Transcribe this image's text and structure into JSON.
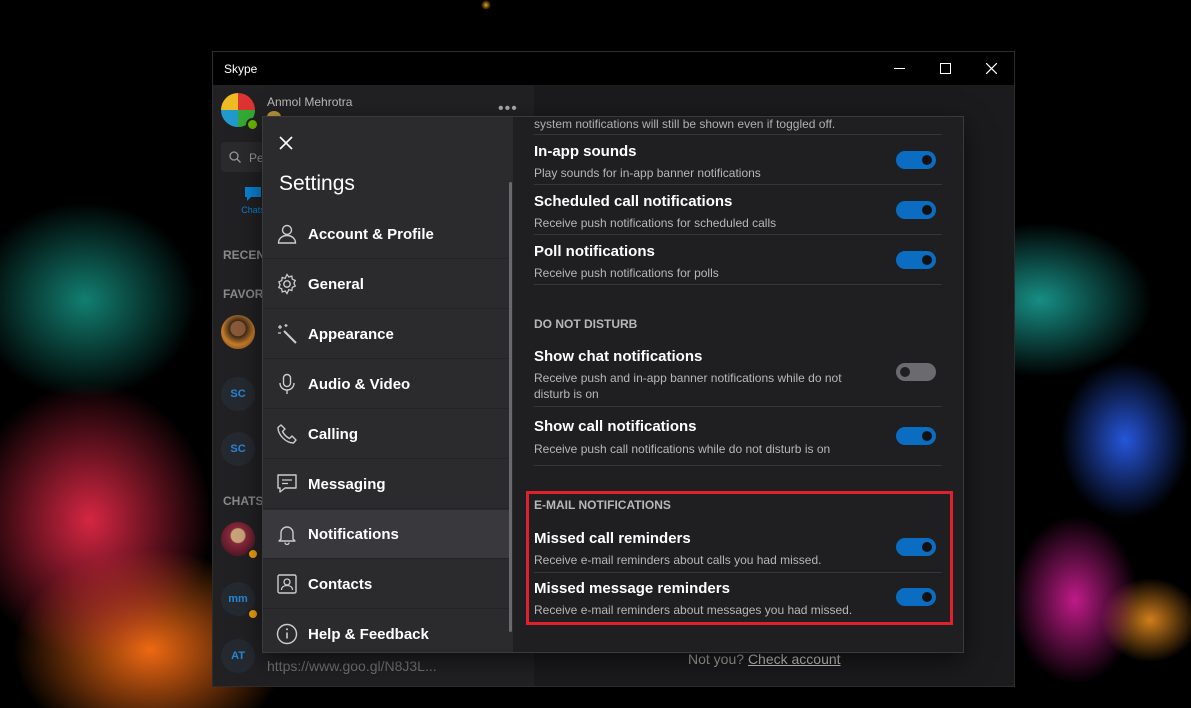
{
  "window": {
    "title": "Skype"
  },
  "window_controls": {
    "minimize": "minimize-icon",
    "maximize": "maximize-icon",
    "close": "close-icon"
  },
  "profile": {
    "name": "Anmol Mehrotra",
    "presence_color": "#6bb700"
  },
  "search": {
    "placeholder": "Pe"
  },
  "tabs": {
    "chats": "Chats"
  },
  "sidebar": {
    "recent": "RECENT",
    "favorites": "FAVOR",
    "chats": "CHATS"
  },
  "contacts": [
    {
      "initials": ""
    },
    {
      "initials": "SC"
    },
    {
      "initials": "SC"
    },
    {
      "initials": ""
    },
    {
      "initials": "mm"
    },
    {
      "initials": "AT"
    }
  ],
  "bottom_link": "https://www.goo.gl/N8J3L...",
  "not_you": {
    "text": "Not you?",
    "link": "Check account"
  },
  "settings": {
    "title": "Settings",
    "nav": [
      {
        "label": "Account & Profile",
        "icon": "person-icon"
      },
      {
        "label": "General",
        "icon": "gear-icon"
      },
      {
        "label": "Appearance",
        "icon": "magic-wand-icon"
      },
      {
        "label": "Audio & Video",
        "icon": "microphone-icon"
      },
      {
        "label": "Calling",
        "icon": "phone-icon"
      },
      {
        "label": "Messaging",
        "icon": "message-icon"
      },
      {
        "label": "Notifications",
        "icon": "bell-icon",
        "active": true
      },
      {
        "label": "Contacts",
        "icon": "contacts-icon"
      },
      {
        "label": "Help & Feedback",
        "icon": "info-icon"
      }
    ],
    "top_note": "system notifications will still be shown even if toggled off.",
    "rows": [
      {
        "title": "In-app sounds",
        "desc": "Play sounds for in-app banner notifications",
        "on": true
      },
      {
        "title": "Scheduled call notifications",
        "desc": "Receive push notifications for scheduled calls",
        "on": true
      },
      {
        "title": "Poll notifications",
        "desc": "Receive push notifications for polls",
        "on": true
      }
    ],
    "dnd": {
      "header": "DO NOT DISTURB",
      "rows": [
        {
          "title": "Show chat notifications",
          "desc_line1": "Receive push and in-app banner notifications while do not",
          "desc_line2": "disturb is on",
          "on": false
        },
        {
          "title": "Show call notifications",
          "desc": "Receive push call notifications while do not disturb is on",
          "on": true
        }
      ]
    },
    "email": {
      "header": "E-MAIL NOTIFICATIONS",
      "rows": [
        {
          "title": "Missed call reminders",
          "desc": "Receive e-mail reminders about calls you had missed.",
          "on": true
        },
        {
          "title": "Missed message reminders",
          "desc": "Receive e-mail reminders about messages you had missed.",
          "on": true
        }
      ]
    }
  },
  "colors": {
    "accent": "#0a6dc2",
    "highlight_box": "#e0202a",
    "toggle_off": "#6b6b6f"
  }
}
